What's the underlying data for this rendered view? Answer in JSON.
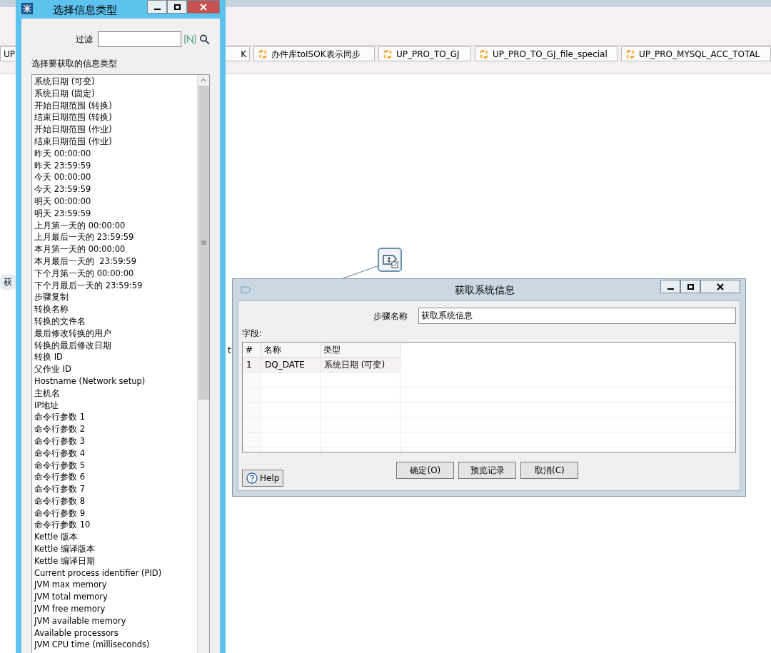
{
  "main_window": {
    "tabs": [
      {
        "label": "UP",
        "selected": false
      },
      {
        "label": "K",
        "selected": false
      },
      {
        "label": "办件库toISOK表示同步",
        "selected": false
      },
      {
        "label": "UP_PRO_TO_GJ",
        "selected": false
      },
      {
        "label": "UP_PRO_TO_GJ_file_special",
        "selected": false
      },
      {
        "label": "UP_PRO_MYSQL_ACC_TOTAL",
        "selected": false
      }
    ],
    "canvas_labels": [
      "获",
      "t"
    ]
  },
  "info_type_dialog": {
    "title": "选择信息类型",
    "filter_label": "过滤",
    "list_label": "选择要获取的信息类型",
    "items": [
      "系统日期 (可变)",
      "系统日期 (固定)",
      "开始日期范围 (转换)",
      "结束日期范围 (转换)",
      "开始日期范围 (作业)",
      "结束日期范围 (作业)",
      "昨天 00:00:00",
      "昨天 23:59:59",
      "今天 00:00:00",
      "今天 23:59:59",
      "明天 00:00:00",
      "明天 23:59:59",
      "上月第一天的 00:00:00",
      "上月最后一天的 23:59:59",
      "本月第一天的 00:00:00",
      "本月最后一天的  23:59:59",
      "下个月第一天的 00:00:00",
      "下个月最后一天的 23:59:59",
      "步骤复制",
      "转换名称",
      "转换的文件名",
      "最后修改转换的用户",
      "转换的最后修改日期",
      "转换 ID",
      "父作业 ID",
      "Hostname (Network setup)",
      "主机名",
      "IP地址",
      "命令行参数 1",
      "命令行参数 2",
      "命令行参数 3",
      "命令行参数 4",
      "命令行参数 5",
      "命令行参数 6",
      "命令行参数 7",
      "命令行参数 8",
      "命令行参数 9",
      "命令行参数 10",
      "Kettle 版本",
      "Kettle 编译版本",
      "Kettle 编译日期",
      "Current process identifier (PID)",
      "JVM max memory",
      "JVM total memory",
      "JVM free memory",
      "JVM available memory",
      "Available processors",
      "JVM CPU time (milliseconds)"
    ]
  },
  "system_info_dialog": {
    "title": "获取系统信息",
    "step_name_label": "步骤名称",
    "step_name_value": "获取系统信息",
    "fields_label": "字段:",
    "columns": [
      "#",
      "名称",
      "类型"
    ],
    "rows": [
      [
        "1",
        "DQ_DATE",
        "系统日期 (可变)"
      ]
    ],
    "buttons": [
      "确定(O)",
      "预览记录",
      "取消(C)"
    ],
    "help": "Help"
  }
}
